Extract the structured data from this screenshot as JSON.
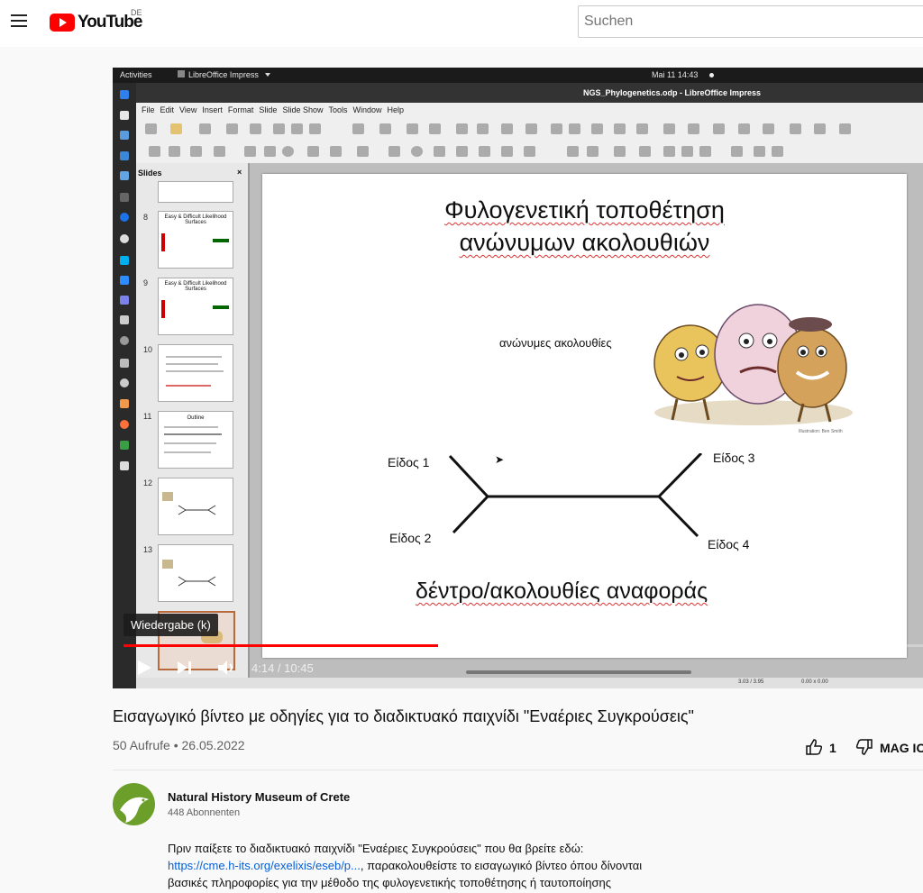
{
  "header": {
    "logo_text": "YouTube",
    "country": "DE",
    "search_placeholder": "Suchen"
  },
  "video": {
    "desktop": {
      "activities": "Activities",
      "app_menu": "LibreOffice Impress",
      "clock": "Mai 11  14:43"
    },
    "window_title": "NGS_Phylogenetics.odp - LibreOffice Impress",
    "menu": [
      "File",
      "Edit",
      "View",
      "Insert",
      "Format",
      "Slide",
      "Slide Show",
      "Tools",
      "Window",
      "Help"
    ],
    "slides_panel": {
      "title": "Slides",
      "close": "×",
      "thumbs": [
        {
          "num": "8",
          "title": "Easy & Difficult Likelihood Surfaces"
        },
        {
          "num": "9",
          "title": "Easy & Difficult Likelihood Surfaces"
        },
        {
          "num": "10",
          "title": ""
        },
        {
          "num": "11",
          "title": "Outline"
        },
        {
          "num": "12",
          "title": ""
        },
        {
          "num": "13",
          "title": ""
        }
      ]
    },
    "slide": {
      "title_line1": "Φυλογενετική τοποθέτηση",
      "title_line2": "ανώνυμων ακολουθιών",
      "anonymous_label": "ανώνυμες ακολουθίες",
      "illustration_credit": "Illustration: Ben Smith",
      "species1": "Είδος 1",
      "species2": "Είδος 2",
      "species3": "Είδος 3",
      "species4": "Είδος 4",
      "bottom_title": "δέντρο/ακολουθίες αναφοράς"
    },
    "status_bar": {
      "position": "3.03 / 3.95",
      "size": "0.00 x 0.00"
    },
    "tooltip": "Wiedergabe (k)",
    "current_time": "4:14",
    "duration": "10:45",
    "time_display": "4:14 / 10:45",
    "progress_fraction": 0.394
  },
  "details": {
    "title": "Εισαγωγικό βίντεο με οδηγίες για το διαδικτυακό παιχνίδι \"Εναέριες Συγκρούσεις\"",
    "meta": "50 Aufrufe • 26.05.2022",
    "likes": "1",
    "save_label": "MAG IC"
  },
  "channel": {
    "name": "Natural History Museum of Crete",
    "subscribers": "448 Abonnenten"
  },
  "description": {
    "line1": "Πριν παίξετε το διαδικτυακό παιχνίδι \"Εναέριες Συγκρούσεις\" που θα βρείτε εδώ:",
    "link": "https://cme.h-its.org/exelixis/eseb/p...",
    "line2_rest": ", παρακολουθείστε το εισαγωγικό βίντεο όπου δίνονται",
    "line3": "βασικές πληροφορίες για την μέθοδο της φυλογενετικής τοποθέτησης ή ταυτοποίησης"
  }
}
